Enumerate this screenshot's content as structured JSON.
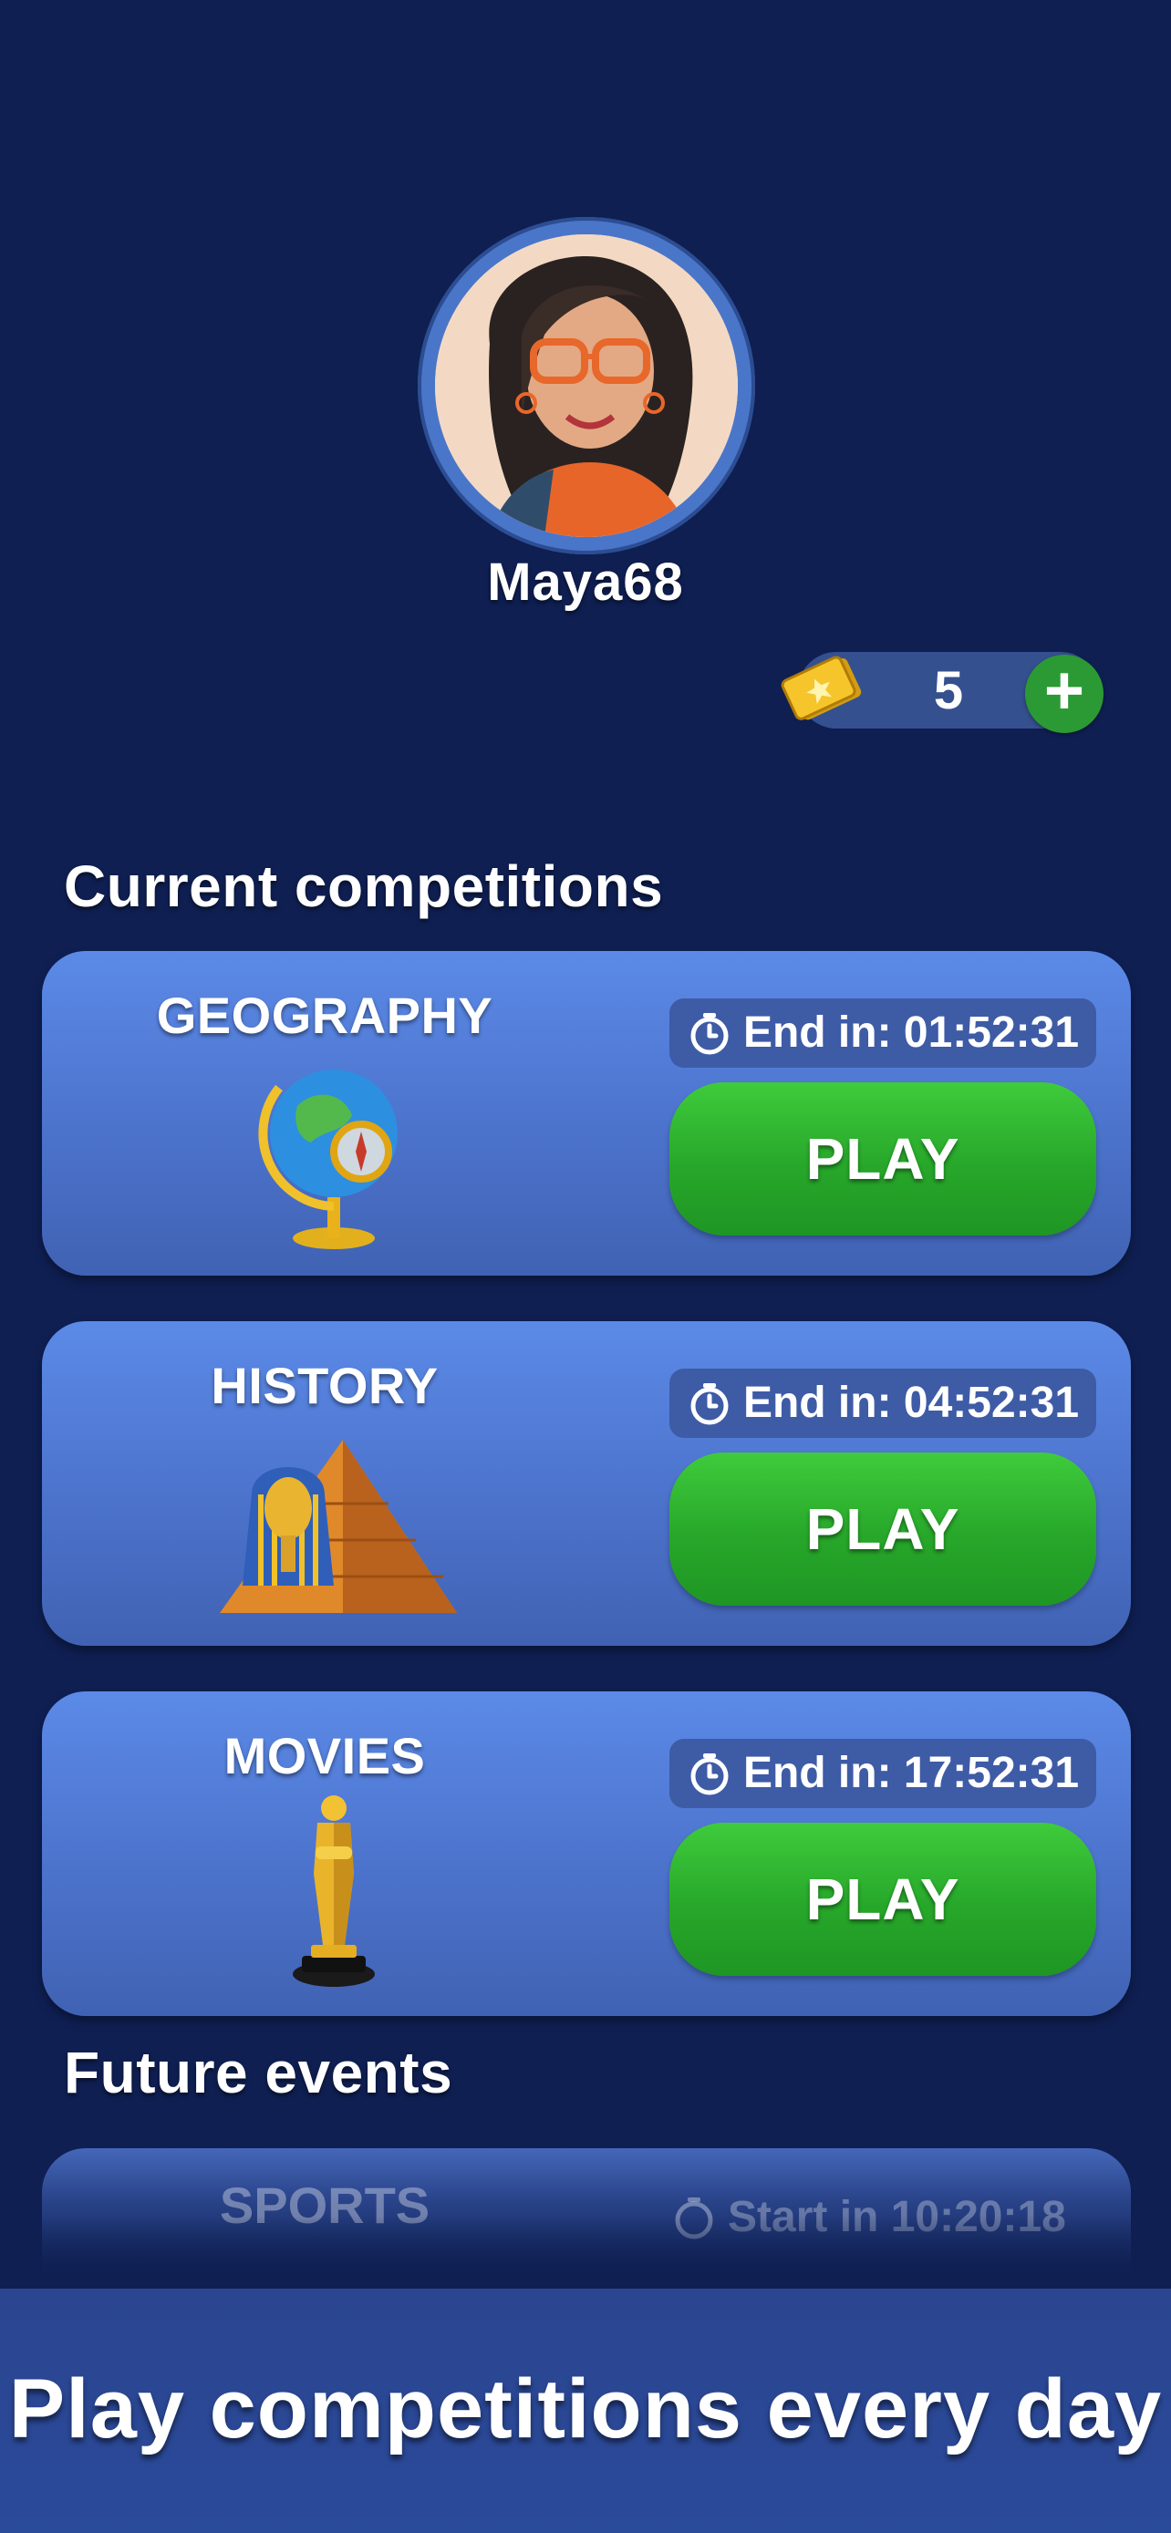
{
  "profile": {
    "username": "Maya68"
  },
  "tickets": {
    "count": "5",
    "add_label": "+"
  },
  "sections": {
    "current_title": "Current competitions",
    "future_title": "Future events"
  },
  "competitions": [
    {
      "name": "GEOGRAPHY",
      "timer_label": "End in: 01:52:31",
      "play_label": "PLAY",
      "icon": "globe-icon"
    },
    {
      "name": "HISTORY",
      "timer_label": "End in: 04:52:31",
      "play_label": "PLAY",
      "icon": "pyramid-pharaoh-icon"
    },
    {
      "name": "MOVIES",
      "timer_label": "End in: 17:52:31",
      "play_label": "PLAY",
      "icon": "oscar-statue-icon"
    }
  ],
  "future_events": [
    {
      "name": "SPORTS",
      "timer_label": "Start in 10:20:18"
    }
  ],
  "banner": {
    "text": "Play competitions every day"
  },
  "colors": {
    "background": "#0f1f52",
    "card": "#4c73cc",
    "play_button": "#27a72a",
    "ticket_add": "#2b9a34",
    "avatar_ring": "#4a76c9"
  }
}
